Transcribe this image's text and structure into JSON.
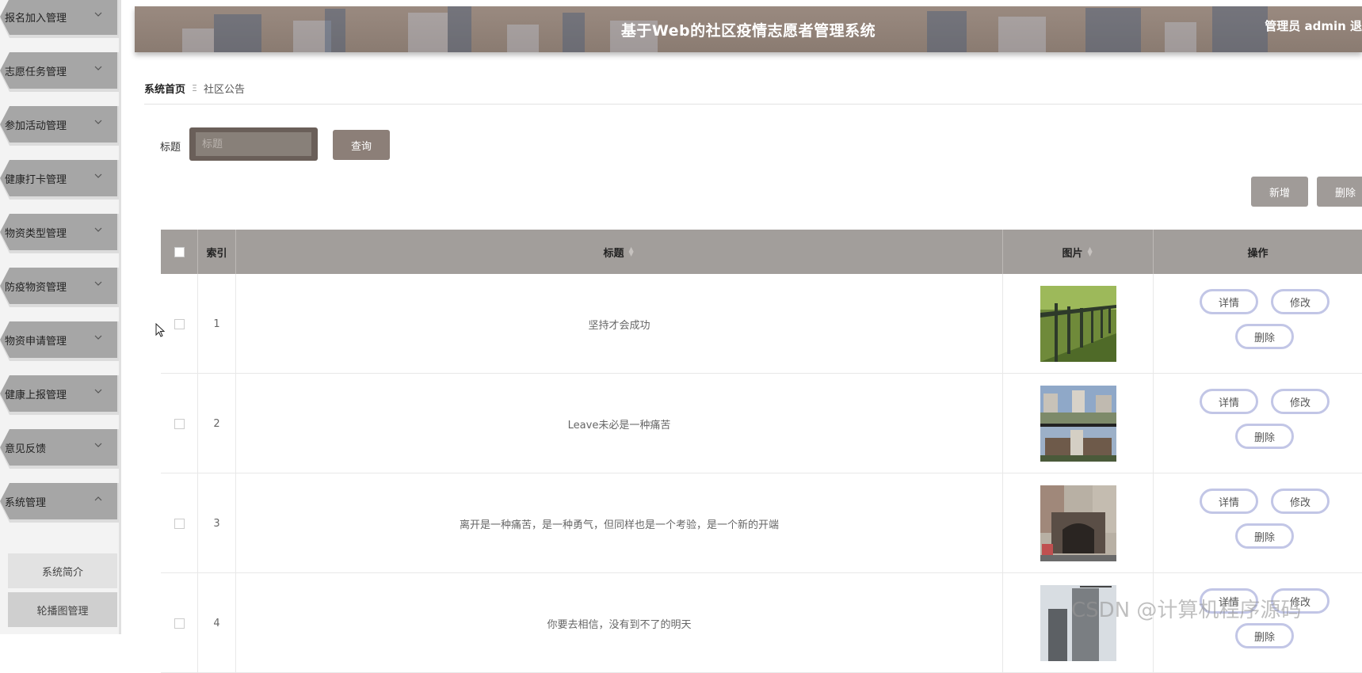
{
  "header": {
    "title": "基于Web的社区疫情志愿者管理系统",
    "admin_text": "管理员 admin  退"
  },
  "sidebar": {
    "items": [
      {
        "label": "报名加入管理",
        "icon": "chevron-down-icon"
      },
      {
        "label": "志愿任务管理",
        "icon": "chevron-down-icon"
      },
      {
        "label": "参加活动管理",
        "icon": "chevron-down-icon"
      },
      {
        "label": "健康打卡管理",
        "icon": "chevron-down-icon"
      },
      {
        "label": "物资类型管理",
        "icon": "chevron-down-icon"
      },
      {
        "label": "防疫物资管理",
        "icon": "chevron-down-icon"
      },
      {
        "label": "物资申请管理",
        "icon": "chevron-down-icon"
      },
      {
        "label": "健康上报管理",
        "icon": "chevron-down-icon"
      },
      {
        "label": "意见反馈",
        "icon": "chevron-down-icon"
      },
      {
        "label": "系统管理",
        "icon": "chevron-up-icon"
      }
    ],
    "sub_items": [
      {
        "label": "系统简介"
      },
      {
        "label": "轮播图管理"
      }
    ]
  },
  "breadcrumb": {
    "home": "系统首页",
    "separator": "Ξ",
    "current": "社区公告"
  },
  "search": {
    "label": "标题",
    "placeholder": "标题",
    "value": "",
    "query_label": "查询"
  },
  "actions": {
    "add_label": "新增",
    "delete_label": "删除"
  },
  "table": {
    "headers": {
      "index": "索引",
      "title": "标题",
      "image": "图片",
      "ops": "操作"
    },
    "rows": [
      {
        "index": "1",
        "title": "坚持才会成功",
        "image": "fence-lawn-photo"
      },
      {
        "index": "2",
        "title": "Leave未必是一种痛苦",
        "image": "building-complex-photo"
      },
      {
        "index": "3",
        "title": "离开是一种痛苦，是一种勇气，但同样也是一个考验，是一个新的开端",
        "image": "community-gate-photo"
      },
      {
        "index": "4",
        "title": "你要去相信，没有到不了的明天",
        "image": "tower-construction-photo"
      }
    ],
    "row_buttons": {
      "detail": "详情",
      "edit": "修改",
      "delete": "删除"
    }
  },
  "watermark": "CSDN @计算机程序源码",
  "colors": {
    "sidebar_item": "#a6a6a6",
    "header_bg": "#8a7b71",
    "table_header": "#a29e9b",
    "op_border": "#c2c6e6",
    "button_bg": "#8c7f78"
  }
}
